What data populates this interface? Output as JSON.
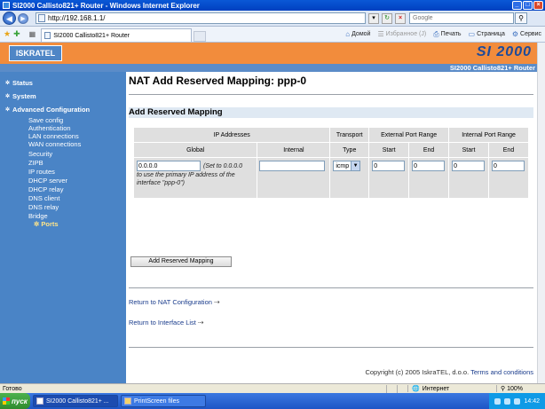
{
  "window": {
    "title": "SI2000 Callisto821+ Router - Windows Internet Explorer",
    "minimize": "_",
    "maximize": "□",
    "close": "×"
  },
  "addressbar": {
    "url": "http://192.168.1.1/",
    "search_placeholder": "Google"
  },
  "tabs": {
    "active_tab": "SI2000 Callisto821+ Router"
  },
  "command_bar": {
    "home": "Домой",
    "feeds": "Избранное (J)",
    "print": "Печать",
    "page": "Страница",
    "tools": "Сервис"
  },
  "banner": {
    "logo": "ISKRATEL",
    "brand": "SI 2000",
    "subtitle": "SI2000 Callisto821+ Router"
  },
  "sidebar": {
    "status": "Status",
    "system": "System",
    "advanced": "Advanced Configuration",
    "sub_items": [
      "Save config",
      "Authentication",
      "LAN connections",
      "WAN connections",
      "Security",
      "ZIPB",
      "IP routes",
      "DHCP server",
      "DHCP relay",
      "DNS client",
      "DNS relay",
      "Bridge"
    ],
    "active_item": "Ports"
  },
  "main": {
    "title": "NAT Add Reserved Mapping: ppp-0",
    "section": "Add Reserved Mapping",
    "table": {
      "group_ip": "IP Addresses",
      "group_transport": "Transport",
      "group_external": "External Port Range",
      "group_internal": "Internal Port Range",
      "col_global": "Global",
      "col_internal": "Internal",
      "col_type": "Type",
      "col_start": "Start",
      "col_end": "End",
      "global_value": "0.0.0.0",
      "global_note_a": "(Set to 0.0.0.0",
      "global_note_b": "to use the primary IP address of the interface \"ppp-0\")",
      "internal_value": "",
      "type_value": "icmp",
      "ext_start": "0",
      "ext_end": "0",
      "int_start": "0",
      "int_end": "0"
    },
    "add_button": "Add Reserved Mapping",
    "link_nat": "Return to NAT Configuration",
    "link_interface": "Return to Interface List",
    "copyright": "Copyright (c) 2005 IskraTEL, d.o.o.",
    "terms": "Terms and conditions"
  },
  "statusbar": {
    "status": "Готово",
    "zone": "Интернет",
    "zoom": "100%"
  },
  "taskbar": {
    "start": "пуск",
    "task1": "SI2000 Callisto821+ ...",
    "task2": "PrintScreen files",
    "time": "14:42"
  }
}
